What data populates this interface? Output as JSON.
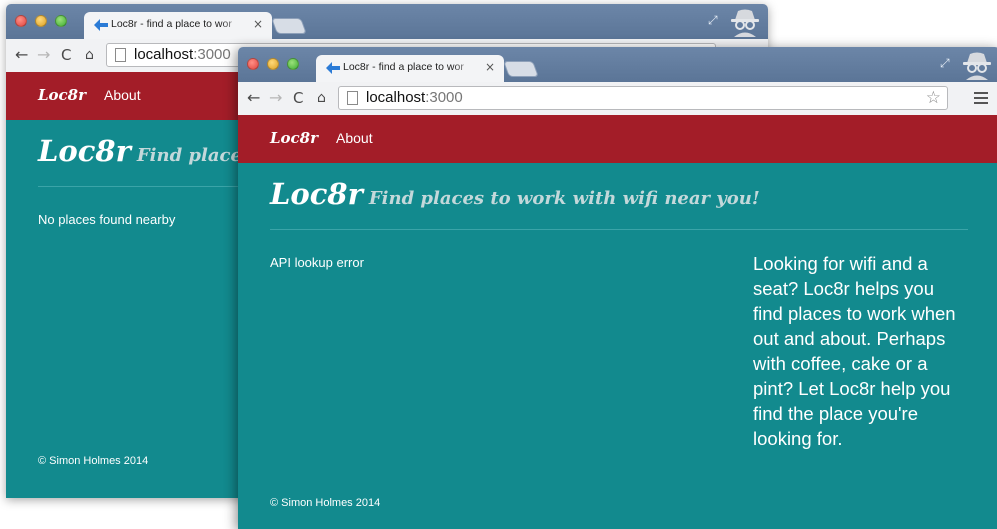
{
  "back_window": {
    "tab_title": "Loc8r - find a place to wor",
    "tab_close": "×",
    "url_host": "localhost",
    "url_port": ":3000",
    "nav_brand": "Loc8r",
    "nav_about": "About",
    "heading_brand": "Loc8r",
    "heading_tagline": "Find places to work with wifi near you!",
    "message": "No places found nearby",
    "footer": "© Simon Holmes 2014"
  },
  "front_window": {
    "tab_title": "Loc8r - find a place to wor",
    "tab_close": "×",
    "url_host": "localhost",
    "url_port": ":3000",
    "nav_brand": "Loc8r",
    "nav_about": "About",
    "heading_brand": "Loc8r",
    "heading_tagline": "Find places to work with wifi near you!",
    "message": "API lookup error",
    "sidebar": "Looking for wifi and a seat? Loc8r helps you find places to work when out and about. Perhaps with coffee, cake or a pint? Let Loc8r help you find the place you're looking for.",
    "footer": "© Simon Holmes 2014"
  },
  "icons": {
    "back": "←",
    "forward": "→",
    "reload": "C",
    "home": "⌂",
    "star": "☆",
    "resize": "⤢"
  },
  "colors": {
    "titlebar": "#5b7597",
    "navbar": "#a31d28",
    "content": "#128a8e",
    "tagline": "#c3d8da"
  }
}
